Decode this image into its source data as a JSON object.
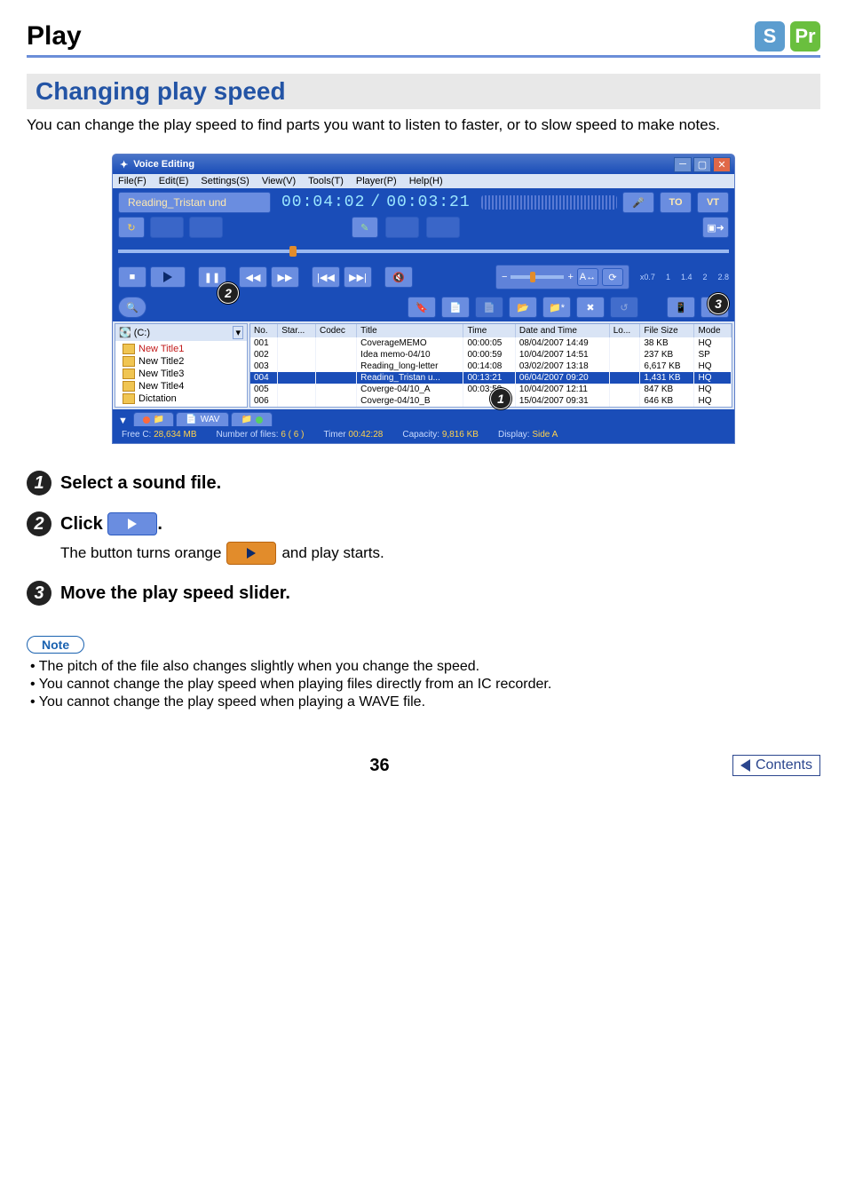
{
  "header": {
    "title": "Play",
    "icon_s": "S",
    "icon_pr": "Pr"
  },
  "section_title": "Changing play speed",
  "intro": "You can change the play speed to find parts you want to listen to faster, or to slow speed to make notes.",
  "app": {
    "window_title": "Voice Editing",
    "menus": [
      "File(F)",
      "Edit(E)",
      "Settings(S)",
      "View(V)",
      "Tools(T)",
      "Player(P)",
      "Help(H)"
    ],
    "now_playing": "Reading_Tristan und",
    "time_elapsed": "00:04:02",
    "time_total": "00:03:21",
    "mic_label": "TO",
    "vt_label": "VT",
    "speed_minus": "−",
    "speed_plus": "+",
    "speed_ticks": [
      "x0.7",
      "1",
      "1.4",
      "2",
      "2.8"
    ],
    "drive_label": "(C:)",
    "folders": [
      "New Title1",
      "New Title2",
      "New Title3",
      "New Title4",
      "Dictation"
    ],
    "columns": [
      "No.",
      "Star...",
      "Codec",
      "Title",
      "Time",
      "Date and Time",
      "Lo...",
      "File Size",
      "Mode"
    ],
    "rows": [
      {
        "no": "001",
        "star": "",
        "codec": "",
        "title": "CoverageMEMO",
        "time": "00:00:05",
        "dt": "08/04/2007 14:49",
        "lo": "",
        "size": "38 KB",
        "mode": "HQ"
      },
      {
        "no": "002",
        "star": "",
        "codec": "",
        "title": "Idea memo-04/10",
        "time": "00:00:59",
        "dt": "10/04/2007 14:51",
        "lo": "",
        "size": "237 KB",
        "mode": "SP"
      },
      {
        "no": "003",
        "star": "",
        "codec": "",
        "title": "Reading_long-letter",
        "time": "00:14:08",
        "dt": "03/02/2007 13:18",
        "lo": "",
        "size": "6,617 KB",
        "mode": "HQ"
      },
      {
        "no": "004",
        "star": "",
        "codec": "",
        "title": "Reading_Tristan u...",
        "time": "00:13:21",
        "dt": "06/04/2007 09:20",
        "lo": "",
        "size": "1,431 KB",
        "mode": "HQ"
      },
      {
        "no": "005",
        "star": "",
        "codec": "",
        "title": "Coverge-04/10_A",
        "time": "00:03:59",
        "dt": "10/04/2007 12:11",
        "lo": "",
        "size": "847 KB",
        "mode": "HQ"
      },
      {
        "no": "006",
        "star": "",
        "codec": "",
        "title": "Coverge-04/10_B",
        "time": "",
        "dt": "15/04/2007 09:31",
        "lo": "",
        "size": "646 KB",
        "mode": "HQ"
      }
    ],
    "tabs": {
      "all": "",
      "wav": "WAV",
      "rec": ""
    },
    "status": {
      "free_label": "Free C:",
      "free_val": "28,634 MB",
      "count_label": "Number of files:",
      "count_val": "6 ( 6 )",
      "timer_label": "Timer",
      "timer_val": "00:42:28",
      "cap_label": "Capacity:",
      "cap_val": "9,816 KB",
      "disp_label": "Display:",
      "disp_val": "Side A"
    },
    "callouts": {
      "c1": "1",
      "c2": "2",
      "c3": "3"
    }
  },
  "steps": {
    "s1": "Select a sound file.",
    "s2": "Click",
    "s2_tail": ".",
    "s2_sub_a": "The button turns orange",
    "s2_sub_b": "and play starts.",
    "s3": "Move the play speed slider."
  },
  "note_label": "Note",
  "notes": [
    "The pitch of the file also changes slightly when you change the speed.",
    "You cannot change the play speed when playing files directly from an IC recorder.",
    "You cannot change the play speed when playing a WAVE file."
  ],
  "page_number": "36",
  "contents_label": "Contents"
}
